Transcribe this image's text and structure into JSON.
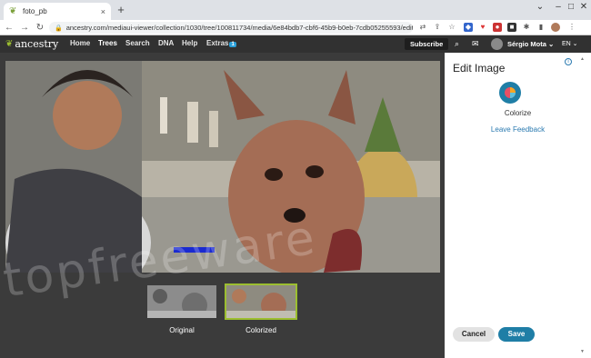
{
  "browser": {
    "tab_title": "foto_pb",
    "url": "ancestry.com/mediaui-viewer/collection/1030/tree/100811734/media/6e84bdb7-cbf6-45b9-b0eb-7cdb05255593/edit?personl...",
    "new_tab": "+",
    "close_tab": "×"
  },
  "nav": {
    "brand": "ancestry",
    "links": [
      "Home",
      "Trees",
      "Search",
      "DNA",
      "Help",
      "Extras"
    ],
    "extras_badge": "1",
    "subscribe": "Subscribe",
    "user_name": "Sérgio Mota",
    "language": "EN"
  },
  "viewer": {
    "thumbnails": [
      "Original",
      "Colorized"
    ]
  },
  "panel": {
    "title": "Edit Image",
    "tool_label": "Colorize",
    "feedback_link": "Leave Feedback",
    "cancel": "Cancel",
    "save": "Save"
  },
  "watermark": "topfreeware",
  "colors": {
    "brand_green": "#9cbe30",
    "nav_bg": "#313131",
    "accent_blue": "#1f7ea6"
  }
}
